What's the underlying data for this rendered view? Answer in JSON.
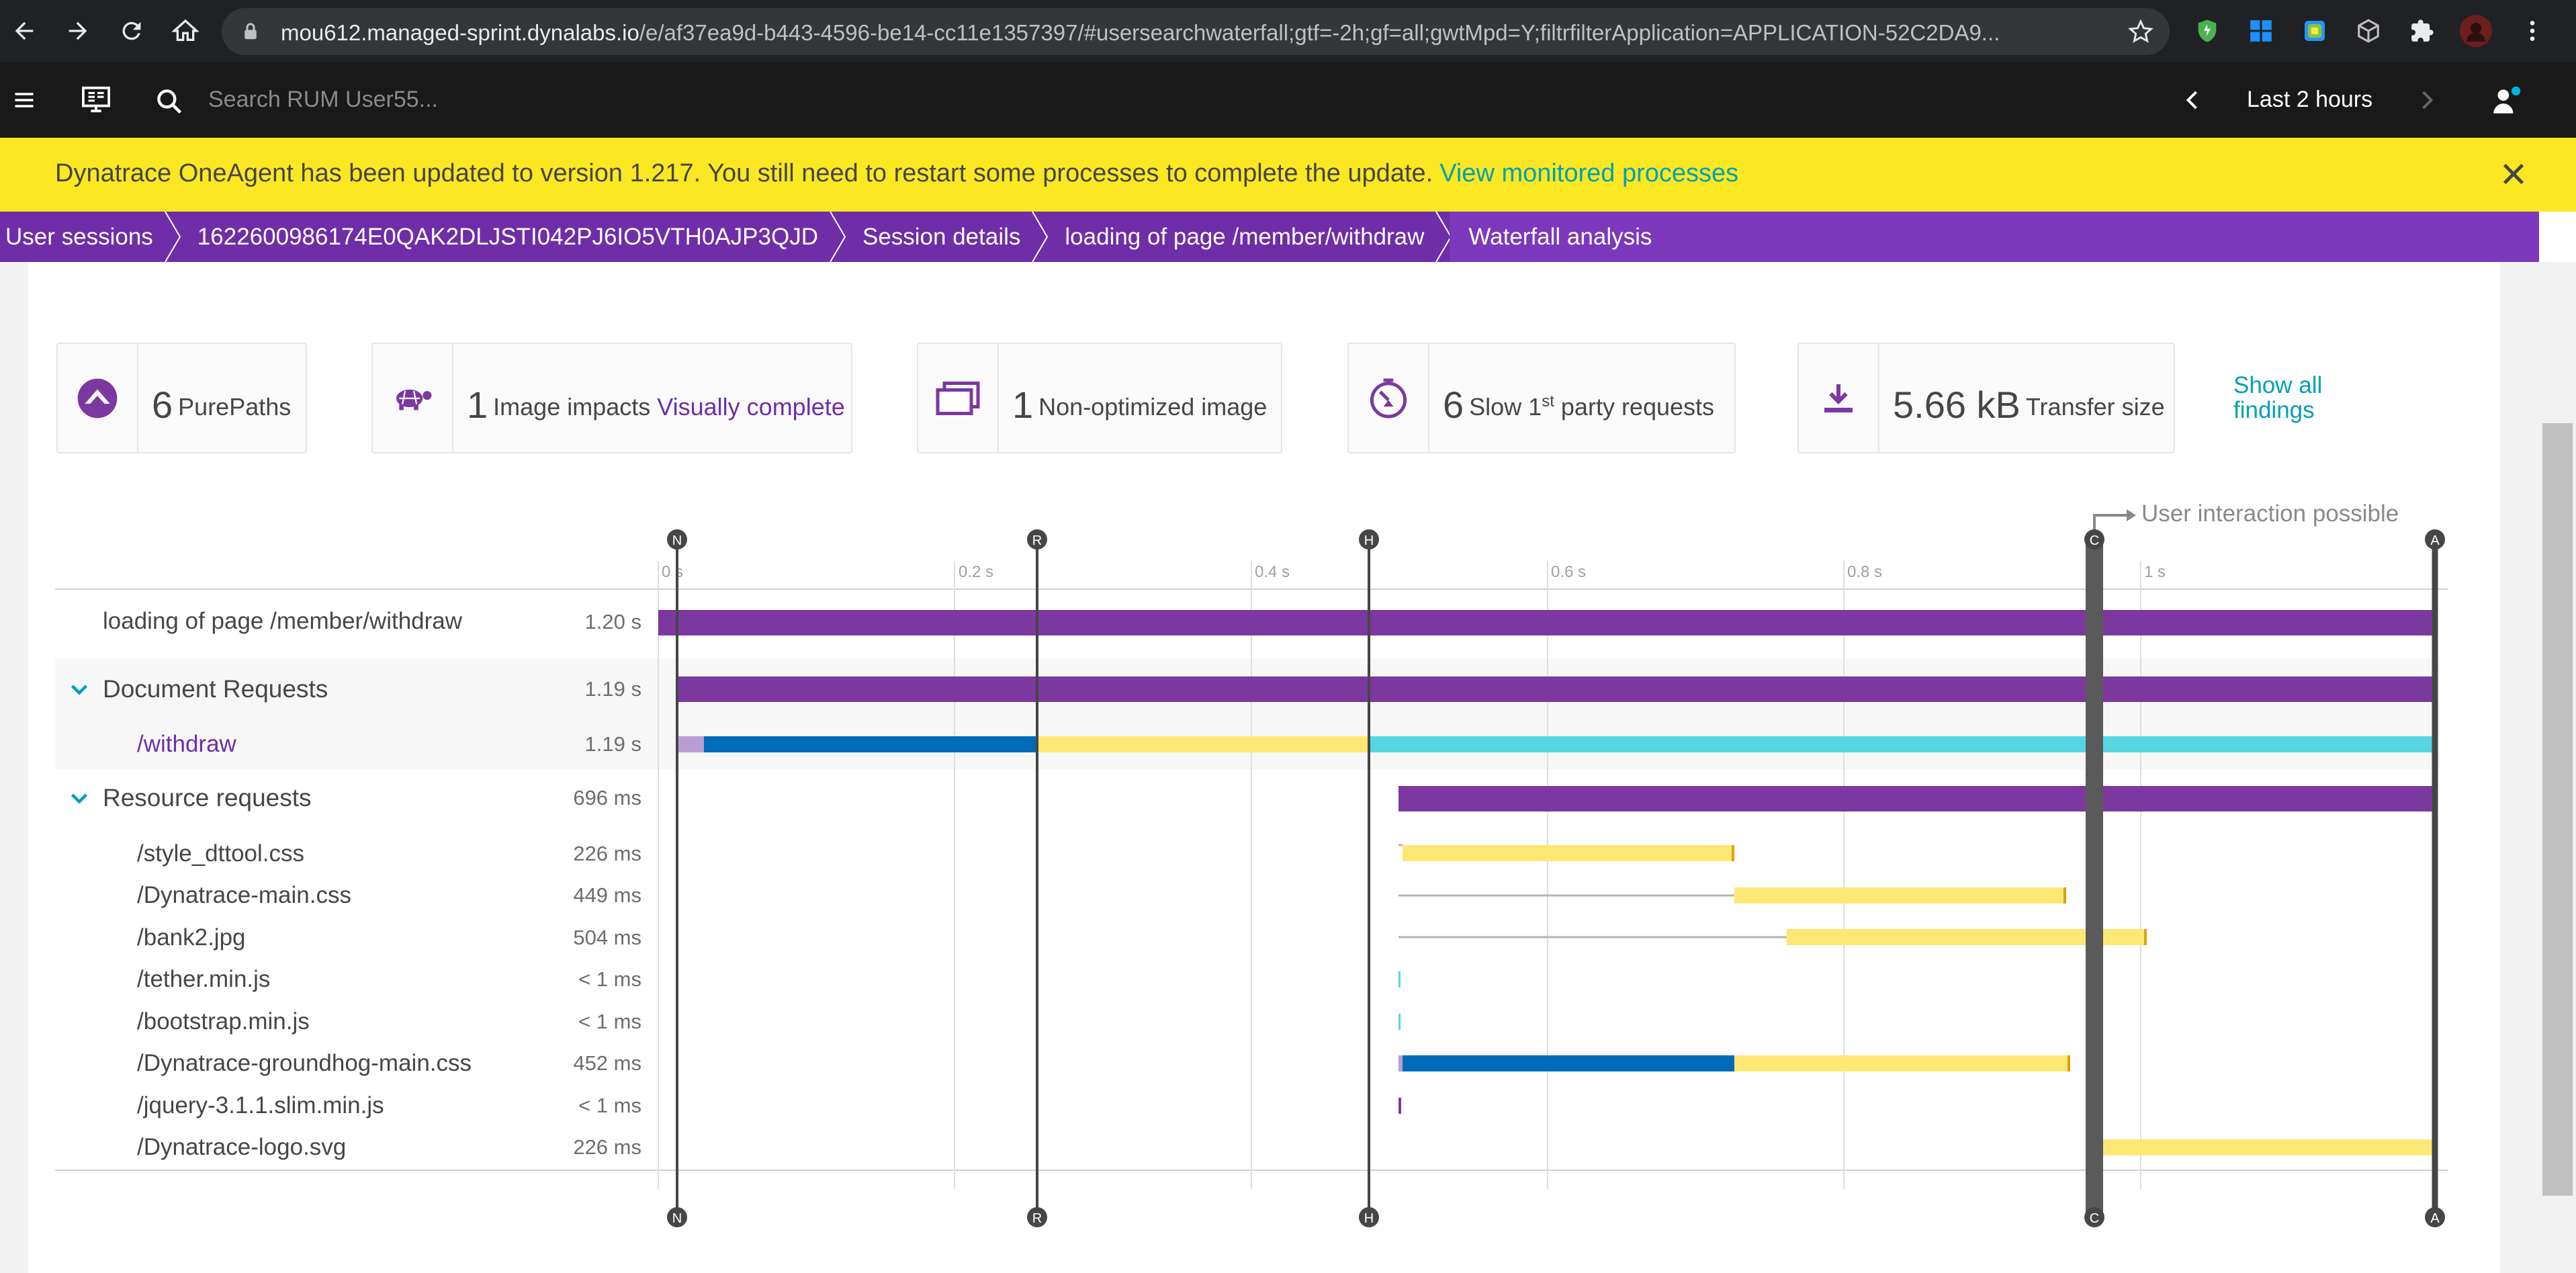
{
  "browser": {
    "url_host": "mou612.managed-sprint.dynalabs.io",
    "url_path": "/e/af37ea9d-b443-4596-be14-cc11e1357397/#usersearchwaterfall;gtf=-2h;gf=all;gwtMpd=Y;filtrfilterApplication=APPLICATION-52C2DA9..."
  },
  "header": {
    "search_placeholder": "Search RUM User55...",
    "timeframe": "Last 2 hours"
  },
  "banner": {
    "message": "Dynatrace OneAgent has been updated to version 1.217. You still need to restart some processes to complete the update.",
    "link": "View monitored processes"
  },
  "breadcrumbs": [
    "User sessions",
    "1622600986174E0QAK2DLJSTI042PJ6IO5VTH0AJP3QJD",
    "Session details",
    "loading of page /member/withdraw",
    "Waterfall analysis"
  ],
  "findings": [
    {
      "number": "6",
      "text": "PurePaths",
      "link": ""
    },
    {
      "number": "1",
      "text": "Image impacts",
      "link": "Visually complete"
    },
    {
      "number": "1",
      "text": "Non-optimized image",
      "link": ""
    },
    {
      "number": "6",
      "text_pre": "Slow 1",
      "sup": "st",
      "text": "party requests",
      "link": ""
    },
    {
      "number": "5.66 kB",
      "text": "Transfer size",
      "link": ""
    }
  ],
  "show_all": {
    "line1": "Show all",
    "line2": "findings"
  },
  "waterfall": {
    "user_interaction_label": "User interaction possible",
    "ticks": [
      "0 s",
      "0.2 s",
      "0.4 s",
      "0.6 s",
      "0.8 s",
      "1 s"
    ],
    "markers": [
      "N",
      "R",
      "H",
      "C",
      "A"
    ],
    "rows": [
      {
        "label": "loading of page /member/withdraw",
        "duration": "1.20 s"
      },
      {
        "label": "Document Requests",
        "duration": "1.19 s"
      },
      {
        "label": "/withdraw",
        "duration": "1.19 s"
      },
      {
        "label": "Resource requests",
        "duration": "696 ms"
      },
      {
        "label": "/style_dttool.css",
        "duration": "226 ms"
      },
      {
        "label": "/Dynatrace-main.css",
        "duration": "449 ms"
      },
      {
        "label": "/bank2.jpg",
        "duration": "504 ms"
      },
      {
        "label": "/tether.min.js",
        "duration": "< 1 ms"
      },
      {
        "label": "/bootstrap.min.js",
        "duration": "< 1 ms"
      },
      {
        "label": "/Dynatrace-groundhog-main.css",
        "duration": "452 ms"
      },
      {
        "label": "/jquery-3.1.1.slim.min.js",
        "duration": "< 1 ms"
      },
      {
        "label": "/Dynatrace-logo.svg",
        "duration": "226 ms"
      }
    ]
  },
  "colors": {
    "purple": "#6f2da8",
    "bar_purple": "#7c38a1",
    "dns_light_purple": "#b99ed6",
    "blue": "#006bb8",
    "yellow": "#fde876",
    "cyan": "#56d6e2",
    "gray_line": "#b4b4b4",
    "banner_yellow": "#fce723",
    "link_teal": "#00a1b2"
  }
}
